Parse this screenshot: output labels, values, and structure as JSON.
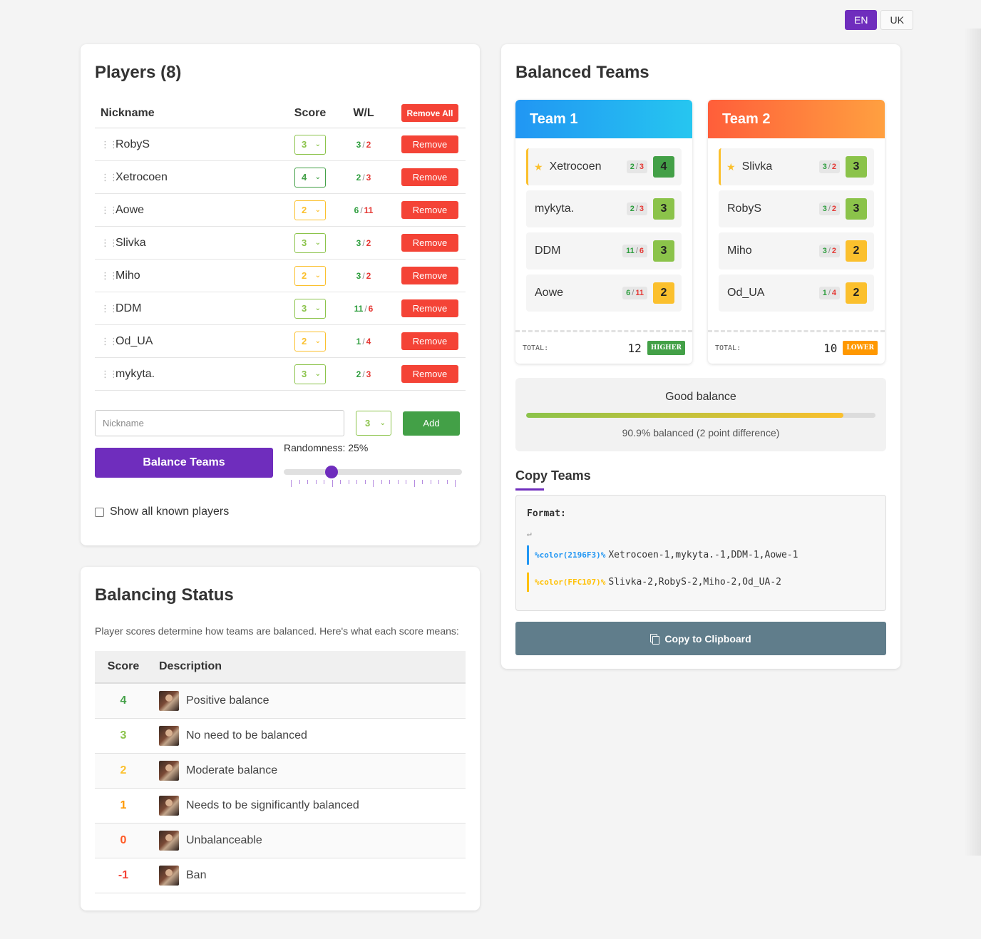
{
  "lang": {
    "en": "EN",
    "uk": "UK"
  },
  "players": {
    "title": "Players (8)",
    "col_nickname": "Nickname",
    "col_score": "Score",
    "col_wl": "W/L",
    "remove_all": "Remove All",
    "remove_label": "Remove",
    "rows": [
      {
        "nick": "RobyS",
        "score": "3",
        "score_color": "#8bc34a",
        "w": "3",
        "l": "2"
      },
      {
        "nick": "Xetrocoen",
        "score": "4",
        "score_color": "#43a047",
        "w": "2",
        "l": "3"
      },
      {
        "nick": "Aowe",
        "score": "2",
        "score_color": "#fbc02d",
        "w": "6",
        "l": "11"
      },
      {
        "nick": "Slivka",
        "score": "3",
        "score_color": "#8bc34a",
        "w": "3",
        "l": "2"
      },
      {
        "nick": "Miho",
        "score": "2",
        "score_color": "#fbc02d",
        "w": "3",
        "l": "2"
      },
      {
        "nick": "DDM",
        "score": "3",
        "score_color": "#8bc34a",
        "w": "11",
        "l": "6"
      },
      {
        "nick": "Od_UA",
        "score": "2",
        "score_color": "#fbc02d",
        "w": "1",
        "l": "4"
      },
      {
        "nick": "mykyta.",
        "score": "3",
        "score_color": "#8bc34a",
        "w": "2",
        "l": "3"
      }
    ],
    "wl_separator": "/",
    "nick_placeholder": "Nickname",
    "new_score": "3",
    "add_label": "Add",
    "balance_label": "Balance Teams",
    "randomness_label": "Randomness: 25%",
    "randomness": 0.25,
    "show_known": "Show all known players"
  },
  "status": {
    "title": "Balancing Status",
    "description": "Player scores determine how teams are balanced. Here's what each score means:",
    "col_score": "Score",
    "col_desc": "Description",
    "rows": [
      {
        "score": "4",
        "color": "#43a047",
        "text": "Positive balance"
      },
      {
        "score": "3",
        "color": "#8bc34a",
        "text": "No need to be balanced"
      },
      {
        "score": "2",
        "color": "#fbc02d",
        "text": "Moderate balance"
      },
      {
        "score": "1",
        "color": "#ff9800",
        "text": "Needs to be significantly balanced"
      },
      {
        "score": "0",
        "color": "#ff5722",
        "text": "Unbalanceable"
      },
      {
        "score": "-1",
        "color": "#f44336",
        "text": "Ban"
      }
    ]
  },
  "teams": {
    "title": "Balanced Teams",
    "team1": {
      "name": "Team 1",
      "players": [
        {
          "nick": "Xetrocoen",
          "w": "2",
          "l": "3",
          "score": "4",
          "captain": true
        },
        {
          "nick": "mykyta.",
          "w": "2",
          "l": "3",
          "score": "3",
          "captain": false
        },
        {
          "nick": "DDM",
          "w": "11",
          "l": "6",
          "score": "3",
          "captain": false
        },
        {
          "nick": "Aowe",
          "w": "6",
          "l": "11",
          "score": "2",
          "captain": false
        }
      ],
      "total_label": "TOTAL:",
      "total": "12",
      "badge": "HIGHER"
    },
    "team2": {
      "name": "Team 2",
      "players": [
        {
          "nick": "Slivka",
          "w": "3",
          "l": "2",
          "score": "3",
          "captain": true
        },
        {
          "nick": "RobyS",
          "w": "3",
          "l": "2",
          "score": "3",
          "captain": false
        },
        {
          "nick": "Miho",
          "w": "3",
          "l": "2",
          "score": "2",
          "captain": false
        },
        {
          "nick": "Od_UA",
          "w": "1",
          "l": "4",
          "score": "2",
          "captain": false
        }
      ],
      "total_label": "TOTAL:",
      "total": "10",
      "badge": "LOWER"
    },
    "balance_title": "Good balance",
    "balance_percent": 90.9,
    "balance_text": "90.9% balanced (2 point difference)"
  },
  "copy": {
    "title": "Copy Teams",
    "format_label": "Format:",
    "return_symbol": "↵",
    "line1_tag": "%color(2196F3)%",
    "line1_text": "Xetrocoen-1,mykyta.-1,DDM-1,Aowe-1",
    "line2_tag": "%color(FFC107)%",
    "line2_text": "Slivka-2,RobyS-2,Miho-2,Od_UA-2",
    "button": "Copy to Clipboard"
  },
  "icons": {
    "drag": "drag-handle-icon",
    "chevron": "chevron-down-icon",
    "star": "star-icon",
    "copy": "copy-icon",
    "checkbox": "checkbox-icon"
  }
}
